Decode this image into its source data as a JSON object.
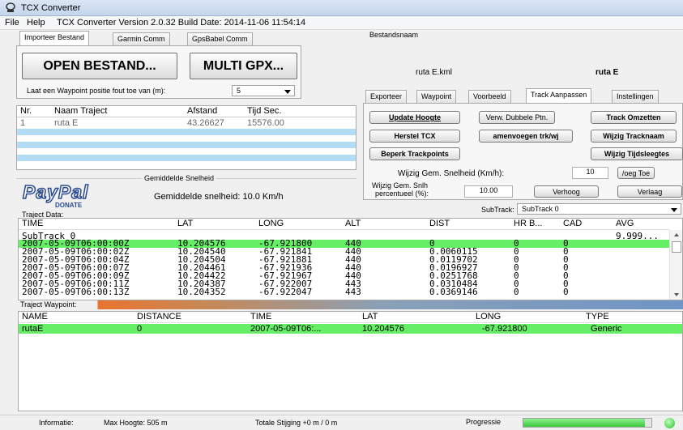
{
  "window": {
    "title": "TCX Converter"
  },
  "menu": {
    "file": "File",
    "help": "Help",
    "version_text": "TCX Converter Version 2.0.32 Build Date: 2014-11-06 11:54:14"
  },
  "left_tabs": [
    "Importeer Bestand",
    "Garmin Comm",
    "GpsBabel Comm"
  ],
  "import": {
    "open_button": "OPEN BESTAND...",
    "multi_button": "MULTI GPX...",
    "waypoint_label": "Laat een Waypoint positie fout toe van (m):",
    "waypoint_value": "5"
  },
  "file_section": {
    "label": "Bestandsnaam",
    "filename": "ruta E.kml",
    "routename": "ruta E"
  },
  "track_table": {
    "headers": [
      "Nr.",
      "Naam Traject",
      "Afstand",
      "Tijd Sec."
    ],
    "rows": [
      [
        "1",
        "ruta E",
        "43.26627",
        "15576.00"
      ]
    ]
  },
  "right_tabs": [
    "Exporteer",
    "Waypoint",
    "Voorbeeld",
    "Track Aanpassen",
    "Instellingen"
  ],
  "track_adjust": {
    "update_height": "Update Hoogte",
    "remove_double": "Verw. Dubbele Ptn.",
    "convert_track": "Track Omzetten",
    "restore_tcx": "Herstel TCX",
    "merge_tracks": "amenvoegen trk/wj",
    "change_trackname": "Wijzig Tracknaam",
    "limit_trackpoints": "Beperk Trackpoints",
    "change_timegaps": "Wijzig Tijdsleegtes",
    "speed_label": "Wijzig Gem. Snelheid (Km/h):",
    "speed_value": "10",
    "speed_apply": "/oeg Toe",
    "pct_label_1": "Wijzig Gem. Snlh",
    "pct_label_2": "percentueel (%):",
    "pct_value": "10.00",
    "increase": "Verhoog",
    "decrease": "Verlaag",
    "subtrack_label": "SubTrack:",
    "subtrack_value": "SubTrack 0"
  },
  "speed_box": {
    "label": "Gemiddelde Snelheid",
    "value_text": "Gemiddelde snelheid: 10.0 Km/h"
  },
  "paypal": {
    "logo": "PayPal",
    "donate": "DONATE"
  },
  "traject_data": {
    "label": "Traject Data:",
    "headers": [
      "TIME",
      "LAT",
      "LONG",
      "ALT",
      "DIST",
      "HR B...",
      "CAD",
      "AVG"
    ],
    "subtrack_row": [
      "SubTrack 0",
      "",
      "",
      "",
      "",
      "",
      "",
      "9.999..."
    ],
    "rows": [
      [
        "2007-05-09T06:00:00Z",
        "10.204576",
        "-67.921800",
        "440",
        "0",
        "0",
        "0",
        ""
      ],
      [
        "2007-05-09T06:00:02Z",
        "10.204540",
        "-67.921841",
        "440",
        "0.0060115",
        "0",
        "0",
        ""
      ],
      [
        "2007-05-09T06:00:04Z",
        "10.204504",
        "-67.921881",
        "440",
        "0.0119702",
        "0",
        "0",
        ""
      ],
      [
        "2007-05-09T06:00:07Z",
        "10.204461",
        "-67.921936",
        "440",
        "0.0196927",
        "0",
        "0",
        ""
      ],
      [
        "2007-05-09T06:00:09Z",
        "10.204422",
        "-67.921967",
        "440",
        "0.0251768",
        "0",
        "0",
        ""
      ],
      [
        "2007-05-09T06:00:11Z",
        "10.204387",
        "-67.922007",
        "443",
        "0.0310484",
        "0",
        "0",
        ""
      ],
      [
        "2007-05-09T06:00:13Z",
        "10.204352",
        "-67.922047",
        "443",
        "0.0369146",
        "0",
        "0",
        ""
      ]
    ]
  },
  "waypoints": {
    "label": "Traject Waypoint:",
    "headers": [
      "NAME",
      "DISTANCE",
      "TIME",
      "LAT",
      "LONG",
      "TYPE"
    ],
    "rows": [
      [
        "rutaE",
        "0",
        "2007-05-09T06:... ",
        "10.204576",
        "-67.921800",
        "Generic"
      ]
    ]
  },
  "status": {
    "info_label": "Informatie:",
    "max_height": "Max Hoogte: 505 m",
    "total_climb": "Totale Stijging +0 m / 0 m",
    "progress_label": "Progressie",
    "progress_fraction": 0.95
  },
  "colors": {
    "highlight": "#66ee66",
    "blue_row": "#b3dcf5",
    "progress": "#4cd84c",
    "paypal_blue": "#2a4a8f"
  }
}
